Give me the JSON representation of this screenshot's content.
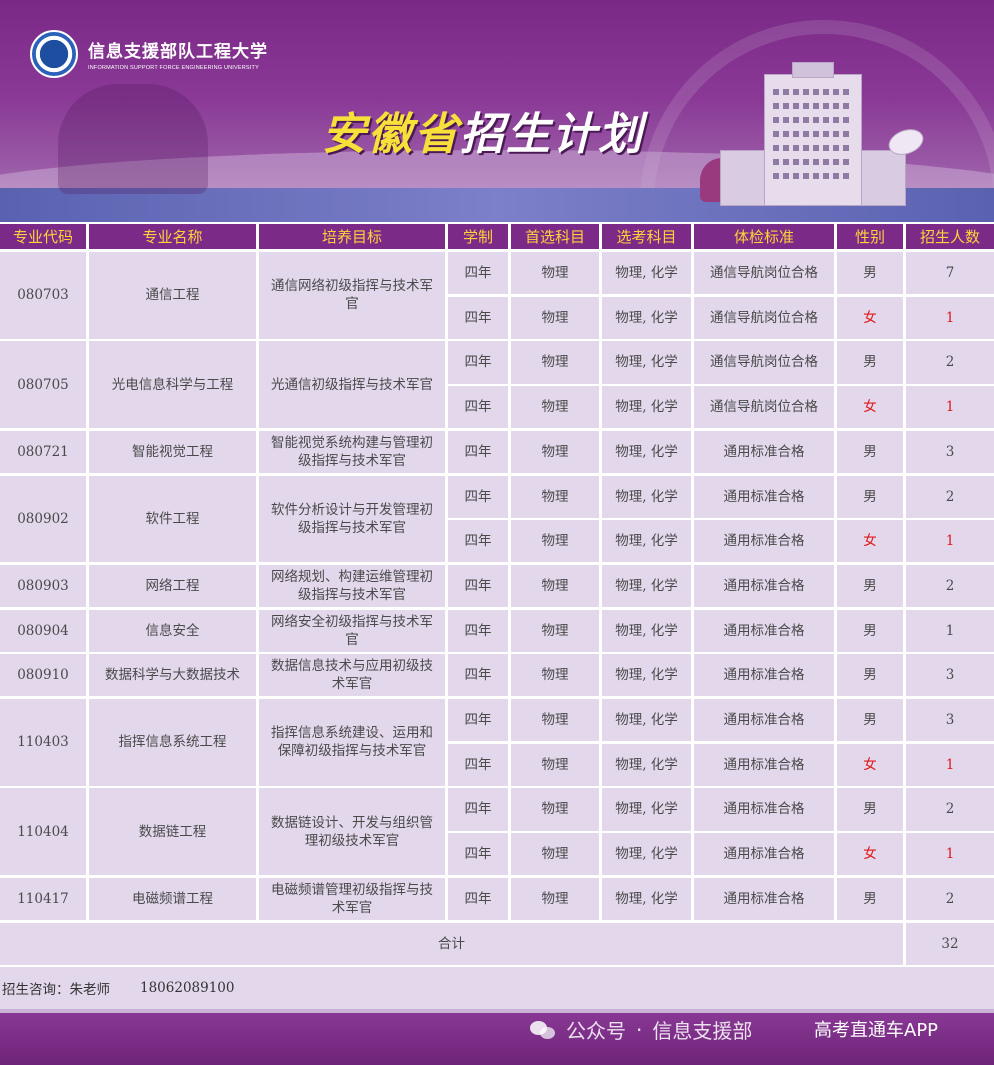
{
  "header": {
    "school_cn": "信息支援部队工程大学",
    "school_en": "INFORMATION SUPPORT FORCE ENGINEERING UNIVERSITY",
    "title_highlight": "安徽省",
    "title_rest": "招生计划"
  },
  "columns": [
    "专业代码",
    "专业名称",
    "培养目标",
    "学制",
    "首选科目",
    "选考科目",
    "体检标准",
    "性别",
    "招生人数"
  ],
  "majors": [
    {
      "code": "080703",
      "name": "通信工程",
      "goal": "通信网络初级指挥与技术军官",
      "rows": [
        {
          "years": "四年",
          "first": "物理",
          "elective": "物理, 化学",
          "medical": "通信导航岗位合格",
          "gender": "男",
          "count": "7"
        },
        {
          "years": "四年",
          "first": "物理",
          "elective": "物理, 化学",
          "medical": "通信导航岗位合格",
          "gender": "女",
          "count": "1"
        }
      ]
    },
    {
      "code": "080705",
      "name": "光电信息科学与工程",
      "goal": "光通信初级指挥与技术军官",
      "rows": [
        {
          "years": "四年",
          "first": "物理",
          "elective": "物理, 化学",
          "medical": "通信导航岗位合格",
          "gender": "男",
          "count": "2"
        },
        {
          "years": "四年",
          "first": "物理",
          "elective": "物理, 化学",
          "medical": "通信导航岗位合格",
          "gender": "女",
          "count": "1"
        }
      ]
    },
    {
      "code": "080721",
      "name": "智能视觉工程",
      "goal": "智能视觉系统构建与管理初级指挥与技术军官",
      "rows": [
        {
          "years": "四年",
          "first": "物理",
          "elective": "物理, 化学",
          "medical": "通用标准合格",
          "gender": "男",
          "count": "3"
        }
      ]
    },
    {
      "code": "080902",
      "name": "软件工程",
      "goal": "软件分析设计与开发管理初级指挥与技术军官",
      "rows": [
        {
          "years": "四年",
          "first": "物理",
          "elective": "物理, 化学",
          "medical": "通用标准合格",
          "gender": "男",
          "count": "2"
        },
        {
          "years": "四年",
          "first": "物理",
          "elective": "物理, 化学",
          "medical": "通用标准合格",
          "gender": "女",
          "count": "1"
        }
      ]
    },
    {
      "code": "080903",
      "name": "网络工程",
      "goal": "网络规划、构建运维管理初级指挥与技术军官",
      "rows": [
        {
          "years": "四年",
          "first": "物理",
          "elective": "物理, 化学",
          "medical": "通用标准合格",
          "gender": "男",
          "count": "2"
        }
      ]
    },
    {
      "code": "080904",
      "name": "信息安全",
      "goal": "网络安全初级指挥与技术军官",
      "rows": [
        {
          "years": "四年",
          "first": "物理",
          "elective": "物理, 化学",
          "medical": "通用标准合格",
          "gender": "男",
          "count": "1"
        }
      ]
    },
    {
      "code": "080910",
      "name": "数据科学与大数据技术",
      "goal": "数据信息技术与应用初级技术军官",
      "rows": [
        {
          "years": "四年",
          "first": "物理",
          "elective": "物理, 化学",
          "medical": "通用标准合格",
          "gender": "男",
          "count": "3"
        }
      ]
    },
    {
      "code": "110403",
      "name": "指挥信息系统工程",
      "goal": "指挥信息系统建设、运用和保障初级指挥与技术军官",
      "rows": [
        {
          "years": "四年",
          "first": "物理",
          "elective": "物理, 化学",
          "medical": "通用标准合格",
          "gender": "男",
          "count": "3"
        },
        {
          "years": "四年",
          "first": "物理",
          "elective": "物理, 化学",
          "medical": "通用标准合格",
          "gender": "女",
          "count": "1"
        }
      ]
    },
    {
      "code": "110404",
      "name": "数据链工程",
      "goal": "数据链设计、开发与组织管理初级技术军官",
      "rows": [
        {
          "years": "四年",
          "first": "物理",
          "elective": "物理, 化学",
          "medical": "通用标准合格",
          "gender": "男",
          "count": "2"
        },
        {
          "years": "四年",
          "first": "物理",
          "elective": "物理, 化学",
          "medical": "通用标准合格",
          "gender": "女",
          "count": "1"
        }
      ]
    },
    {
      "code": "110417",
      "name": "电磁频谱工程",
      "goal": "电磁频谱管理初级指挥与技术军官",
      "rows": [
        {
          "years": "四年",
          "first": "物理",
          "elective": "物理, 化学",
          "medical": "通用标准合格",
          "gender": "男",
          "count": "2"
        }
      ]
    }
  ],
  "total": {
    "label": "合计",
    "value": "32"
  },
  "contact": {
    "label": "招生咨询：朱老师",
    "phone": "18062089100"
  },
  "footer": {
    "wechat_prefix": "公众号",
    "separator": "·",
    "wechat_name": "信息支援部",
    "app_name": "高考直通车APP"
  },
  "colors": {
    "header_purple": "#7b2a88",
    "header_text": "#ffd23a",
    "cell_bg": "#e3d7ec",
    "female_red": "#e01818",
    "title_yellow": "#f7e03a"
  }
}
